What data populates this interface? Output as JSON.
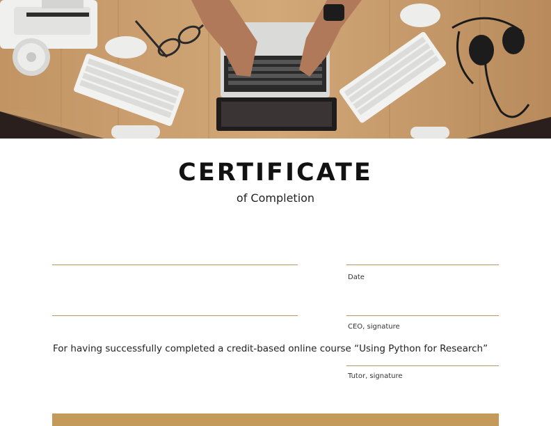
{
  "certificate": {
    "title": "CERTIFICATE",
    "subtitle": "of Completion",
    "statement": "For having successfully completed a credit-based online course “Using Python for Research”"
  },
  "signature_fields": {
    "date_label": "Date",
    "ceo_label": "CEO, signature",
    "tutor_label": "Tutor, signature"
  },
  "colors": {
    "accent": "#c49a5a",
    "rule": "#b8965e",
    "text": "#121212",
    "desk_wood": "#c79a6a",
    "corner_dark": "#2a1f1c"
  },
  "hero_image": {
    "icons": [
      "laptop-icon",
      "keyboard-icon",
      "mouse-icon",
      "headphones-icon",
      "glasses-icon",
      "coffee-cup-icon",
      "watch-icon"
    ]
  }
}
